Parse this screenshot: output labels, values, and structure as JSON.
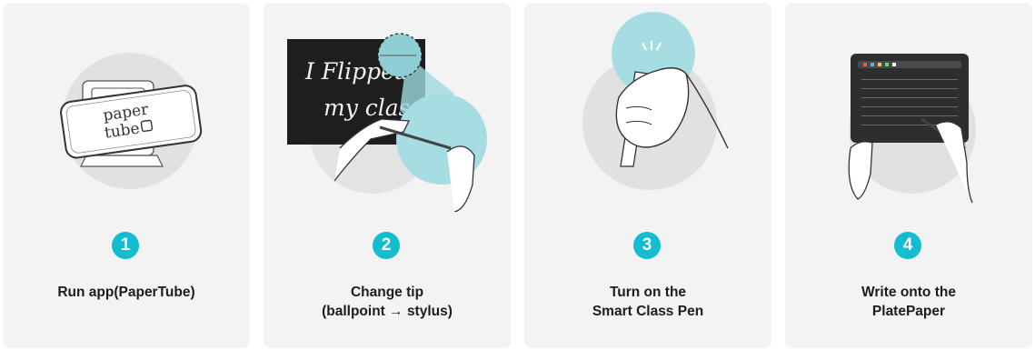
{
  "colors": {
    "accent": "#13bcd0",
    "card_bg": "#f3f3f3",
    "teal_circle": "#a6dde3"
  },
  "steps": [
    {
      "number": "1",
      "caption_lines": [
        "Run app(PaperTube)"
      ],
      "logo_line1": "paper",
      "logo_line2": "tube",
      "icon": "phone-on-stand-icon"
    },
    {
      "number": "2",
      "caption_lines": [
        "Change tip",
        "(ballpoint → stylus)"
      ],
      "board_line1": "I Flipped",
      "board_line2": "my class",
      "icon": "pen-tip-icon"
    },
    {
      "number": "3",
      "caption_lines": [
        "Turn on the",
        "Smart Class Pen"
      ],
      "icon": "hand-holding-pen-icon"
    },
    {
      "number": "4",
      "caption_lines": [
        "Write onto the",
        "PlatePaper"
      ],
      "icon": "plate-paper-icon"
    }
  ]
}
